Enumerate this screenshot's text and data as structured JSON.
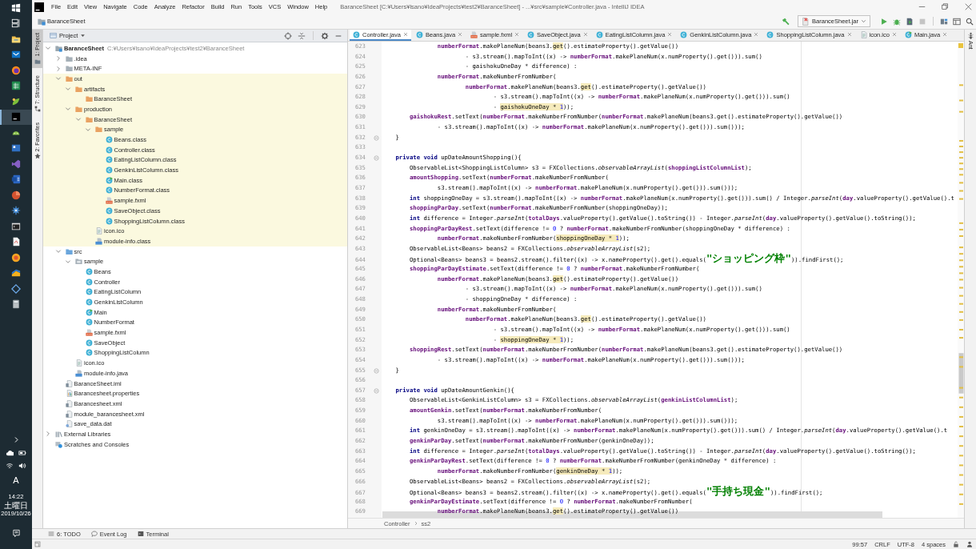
{
  "taskbar": {
    "apps": [
      {
        "selected": false
      },
      {
        "selected": false
      },
      {
        "selected": false
      },
      {
        "selected": false
      },
      {
        "selected": false
      },
      {
        "selected": true
      },
      {
        "selected": false
      },
      {
        "selected": false
      },
      {
        "selected": false
      },
      {
        "selected": false
      },
      {
        "selected": false
      },
      {
        "selected": false
      },
      {
        "selected": false
      },
      {
        "selected": false
      },
      {
        "selected": false
      },
      {
        "selected": false
      },
      {
        "selected": false
      },
      {
        "selected": false
      }
    ],
    "ime": "A",
    "clock": {
      "time": "14:22",
      "weekday": "土曜日",
      "date": "2019/10/26"
    }
  },
  "window": {
    "menus": [
      "File",
      "Edit",
      "View",
      "Navigate",
      "Code",
      "Analyze",
      "Refactor",
      "Build",
      "Run",
      "Tools",
      "VCS",
      "Window",
      "Help"
    ],
    "title": "BaranceSheet [C:¥Users¥lsano¥IdeaProjects¥test2¥BaranceSheet] - ...¥src¥sample¥Controller.java - IntelliJ IDEA"
  },
  "navigation_bar": {
    "breadcrumb": "BaranceSheet",
    "run_configuration": "BaranceSheet.jar",
    "stop_button": {
      "disabled": true
    }
  },
  "left_tool_stripe": [
    {
      "label": "1: Project",
      "selected": true
    },
    {
      "label": "7: Structure",
      "selected": false
    },
    {
      "label": "2: Favorites",
      "selected": false
    }
  ],
  "project_panel": {
    "title": "Project",
    "tree": [
      {
        "label": "BaranceSheet",
        "kind": "module",
        "hint": "C:¥Users¥lsano¥IdeaProjects¥test2¥BaranceSheet",
        "expanded": true,
        "excluded": false,
        "children": [
          {
            "label": ".idea",
            "kind": "folder",
            "expanded": false,
            "excluded": false
          },
          {
            "label": "META-INF",
            "kind": "folder",
            "expanded": false,
            "excluded": false
          },
          {
            "label": "out",
            "kind": "folder",
            "expanded": true,
            "excluded": true,
            "children": [
              {
                "label": "artifacts",
                "kind": "folder",
                "expanded": true,
                "excluded": true,
                "children": [
                  {
                    "label": "BaranceSheet",
                    "kind": "folder",
                    "excluded": true
                  }
                ]
              },
              {
                "label": "production",
                "kind": "folder",
                "expanded": true,
                "excluded": true,
                "children": [
                  {
                    "label": "BaranceSheet",
                    "kind": "folder",
                    "expanded": true,
                    "excluded": true,
                    "children": [
                      {
                        "label": "sample",
                        "kind": "folder",
                        "expanded": true,
                        "excluded": true,
                        "children": [
                          {
                            "label": "Beans.class",
                            "kind": "class",
                            "excluded": true
                          },
                          {
                            "label": "Controller.class",
                            "kind": "class",
                            "excluded": true
                          },
                          {
                            "label": "EatingListColumn.class",
                            "kind": "class",
                            "excluded": true
                          },
                          {
                            "label": "GenkinListColumn.class",
                            "kind": "class",
                            "excluded": true
                          },
                          {
                            "label": "Main.class",
                            "kind": "main-class",
                            "excluded": true
                          },
                          {
                            "label": "NumberFormat.class",
                            "kind": "class",
                            "excluded": true
                          },
                          {
                            "label": "sample.fxml",
                            "kind": "fxml",
                            "excluded": true
                          },
                          {
                            "label": "SaveObject.class",
                            "kind": "class",
                            "excluded": true
                          },
                          {
                            "label": "ShoppingListColumn.class",
                            "kind": "class",
                            "excluded": true
                          }
                        ]
                      },
                      {
                        "label": "icon.ico",
                        "kind": "image",
                        "excluded": true
                      },
                      {
                        "label": "module-info.class",
                        "kind": "module-info",
                        "excluded": true
                      }
                    ]
                  }
                ]
              }
            ]
          },
          {
            "label": "src",
            "kind": "source-folder",
            "expanded": true,
            "excluded": false,
            "children": [
              {
                "label": "sample",
                "kind": "package",
                "expanded": true,
                "excluded": false,
                "children": [
                  {
                    "label": "Beans",
                    "kind": "class",
                    "excluded": false
                  },
                  {
                    "label": "Controller",
                    "kind": "class",
                    "excluded": false
                  },
                  {
                    "label": "EatingListColumn",
                    "kind": "class",
                    "excluded": false
                  },
                  {
                    "label": "GenkinListColumn",
                    "kind": "class",
                    "excluded": false
                  },
                  {
                    "label": "Main",
                    "kind": "main-class",
                    "excluded": false
                  },
                  {
                    "label": "NumberFormat",
                    "kind": "class",
                    "excluded": false
                  },
                  {
                    "label": "sample.fxml",
                    "kind": "fxml",
                    "excluded": false
                  },
                  {
                    "label": "SaveObject",
                    "kind": "class",
                    "excluded": false
                  },
                  {
                    "label": "ShoppingListColumn",
                    "kind": "class",
                    "excluded": false
                  }
                ]
              },
              {
                "label": "icon.ico",
                "kind": "image",
                "excluded": false
              },
              {
                "label": "module-info.java",
                "kind": "module-info",
                "excluded": false
              }
            ]
          },
          {
            "label": "BaranceSheet.iml",
            "kind": "iml",
            "excluded": false
          },
          {
            "label": "Barancesheet.properties",
            "kind": "properties",
            "excluded": false
          },
          {
            "label": "Barancesheet.xml",
            "kind": "xml",
            "excluded": false
          },
          {
            "label": "module_barancesheet.xml",
            "kind": "xml",
            "excluded": false
          },
          {
            "label": "save_data.dat",
            "kind": "data",
            "excluded": false
          }
        ]
      },
      {
        "label": "External Libraries",
        "kind": "libraries",
        "expanded": false,
        "excluded": false
      },
      {
        "label": "Scratches and Consoles",
        "kind": "scratches",
        "excluded": false
      }
    ]
  },
  "editor": {
    "tabs": [
      {
        "label": "Controller.java",
        "kind": "class",
        "selected": true
      },
      {
        "label": "Beans.java",
        "kind": "class",
        "selected": false
      },
      {
        "label": "sample.fxml",
        "kind": "fxml",
        "selected": false
      },
      {
        "label": "SaveObject.java",
        "kind": "class",
        "selected": false
      },
      {
        "label": "EatingListColumn.java",
        "kind": "class",
        "selected": false
      },
      {
        "label": "GenkinListColumn.java",
        "kind": "class",
        "selected": false
      },
      {
        "label": "ShoppingListColumn.java",
        "kind": "class",
        "selected": false
      },
      {
        "label": "icon.ico",
        "kind": "image",
        "selected": false
      },
      {
        "label": "Main.java",
        "kind": "main-class",
        "selected": false
      }
    ],
    "lines": [
      {
        "number": "623",
        "fold": false,
        "code": [
          {
            "text": "                numberFormat",
            "kind": "field"
          },
          {
            "text": ".makePlaneNum(beans3.",
            "kind": "plain"
          },
          {
            "text": "get",
            "kind": "warning"
          },
          {
            "text": "().estimateProperty().getValue())",
            "kind": "plain"
          }
        ]
      },
      {
        "number": "624",
        "fold": false,
        "code": [
          {
            "text": "                        - s3.stream().mapToInt((x) -> ",
            "kind": "plain"
          },
          {
            "text": "numberFormat",
            "kind": "field"
          },
          {
            "text": ".makePlaneNum(x.numProperty().get())).sum()",
            "kind": "plain"
          }
        ]
      },
      {
        "number": "625",
        "fold": false,
        "code": [
          {
            "text": "                        - gaishokuOneDay * difference) :",
            "kind": "plain"
          }
        ]
      },
      {
        "number": "626",
        "fold": false,
        "code": [
          {
            "text": "                numberFormat",
            "kind": "field"
          },
          {
            "text": ".makeNumberFromNumber(",
            "kind": "plain"
          }
        ]
      },
      {
        "number": "627",
        "fold": false,
        "code": [
          {
            "text": "                        numberFormat",
            "kind": "field"
          },
          {
            "text": ".makePlaneNum(beans3.",
            "kind": "plain"
          },
          {
            "text": "get",
            "kind": "warning"
          },
          {
            "text": "().estimateProperty().getValue())",
            "kind": "plain"
          }
        ]
      },
      {
        "number": "628",
        "fold": false,
        "code": [
          {
            "text": "                                - s3.stream().mapToInt((x) -> ",
            "kind": "plain"
          },
          {
            "text": "numberFormat",
            "kind": "field"
          },
          {
            "text": ".makePlaneNum(x.numProperty().get())).sum()",
            "kind": "plain"
          }
        ]
      },
      {
        "number": "629",
        "fold": false,
        "code": [
          {
            "text": "                                - ",
            "kind": "plain"
          },
          {
            "text": "gaishokuOneDay * ",
            "kind": "warning"
          },
          {
            "text": "1",
            "kind": "warningnumber"
          },
          {
            "text": "));",
            "kind": "plain"
          }
        ]
      },
      {
        "number": "630",
        "fold": false,
        "code": [
          {
            "text": "        gaishokuRest",
            "kind": "field"
          },
          {
            "text": ".setText(",
            "kind": "plain"
          },
          {
            "text": "numberFormat",
            "kind": "field"
          },
          {
            "text": ".makeNumberFromNumber(",
            "kind": "plain"
          },
          {
            "text": "numberFormat",
            "kind": "field"
          },
          {
            "text": ".makePlaneNum(beans3.get().estimateProperty().getValue())",
            "kind": "plain"
          }
        ]
      },
      {
        "number": "631",
        "fold": false,
        "code": [
          {
            "text": "                - s3.stream().mapToInt((x) -> ",
            "kind": "plain"
          },
          {
            "text": "numberFormat",
            "kind": "field"
          },
          {
            "text": ".makePlaneNum(x.numProperty().get())).sum()));",
            "kind": "plain"
          }
        ]
      },
      {
        "number": "632",
        "fold": true,
        "code": [
          {
            "text": "    }",
            "kind": "plain"
          }
        ]
      },
      {
        "number": "633",
        "fold": false
      },
      {
        "number": "634",
        "fold": true,
        "code": [
          {
            "text": "    private void",
            "kind": "keyword"
          },
          {
            "text": " upDateAmountShopping(){",
            "kind": "plain"
          }
        ]
      },
      {
        "number": "635",
        "fold": false,
        "code": [
          {
            "text": "        ObservableList<ShoppingListColumn> s3 = FXCollections.",
            "kind": "plain"
          },
          {
            "text": "observableArrayList",
            "kind": "static"
          },
          {
            "text": "(",
            "kind": "plain"
          },
          {
            "text": "shoppingListColumnList",
            "kind": "field"
          },
          {
            "text": ");",
            "kind": "plain"
          }
        ]
      },
      {
        "number": "636",
        "fold": false,
        "code": [
          {
            "text": "        amountShopping",
            "kind": "field"
          },
          {
            "text": ".setText(",
            "kind": "plain"
          },
          {
            "text": "numberFormat",
            "kind": "field"
          },
          {
            "text": ".makeNumberFromNumber(",
            "kind": "plain"
          }
        ]
      },
      {
        "number": "637",
        "fold": false,
        "code": [
          {
            "text": "                s3.stream().mapToInt((x) -> ",
            "kind": "plain"
          },
          {
            "text": "numberFormat",
            "kind": "field"
          },
          {
            "text": ".makePlaneNum(x.numProperty().get())).sum()));",
            "kind": "plain"
          }
        ]
      },
      {
        "number": "638",
        "fold": false,
        "code": [
          {
            "text": "        int",
            "kind": "keyword"
          },
          {
            "text": " shoppingOneDay = s3.stream().mapToInt((x) -> ",
            "kind": "plain"
          },
          {
            "text": "numberFormat",
            "kind": "field"
          },
          {
            "text": ".makePlaneNum(x.numProperty().get())).sum() / Integer.",
            "kind": "plain"
          },
          {
            "text": "parseInt",
            "kind": "static"
          },
          {
            "text": "(",
            "kind": "plain"
          },
          {
            "text": "day",
            "kind": "field"
          },
          {
            "text": ".valueProperty().getValue().t",
            "kind": "plain"
          }
        ]
      },
      {
        "number": "639",
        "fold": false,
        "code": [
          {
            "text": "        shoppingParDay",
            "kind": "field"
          },
          {
            "text": ".setText(",
            "kind": "plain"
          },
          {
            "text": "numberFormat",
            "kind": "field"
          },
          {
            "text": ".makeNumberFromNumber(shoppingOneDay));",
            "kind": "plain"
          }
        ]
      },
      {
        "number": "640",
        "fold": false,
        "code": [
          {
            "text": "        int",
            "kind": "keyword"
          },
          {
            "text": " difference = Integer.",
            "kind": "plain"
          },
          {
            "text": "parseInt",
            "kind": "static"
          },
          {
            "text": "(",
            "kind": "plain"
          },
          {
            "text": "totalDays",
            "kind": "field"
          },
          {
            "text": ".valueProperty().getValue().toString()) - Integer.",
            "kind": "plain"
          },
          {
            "text": "parseInt",
            "kind": "static"
          },
          {
            "text": "(",
            "kind": "plain"
          },
          {
            "text": "day",
            "kind": "field"
          },
          {
            "text": ".valueProperty().getValue().toString());",
            "kind": "plain"
          }
        ]
      },
      {
        "number": "641",
        "fold": false,
        "code": [
          {
            "text": "        shoppingParDayRest",
            "kind": "field"
          },
          {
            "text": ".setText(difference != ",
            "kind": "plain"
          },
          {
            "text": "0",
            "kind": "number"
          },
          {
            "text": " ? ",
            "kind": "plain"
          },
          {
            "text": "numberFormat",
            "kind": "field"
          },
          {
            "text": ".makeNumberFromNumber(shoppingOneDay * difference) :",
            "kind": "plain"
          }
        ]
      },
      {
        "number": "642",
        "fold": false,
        "code": [
          {
            "text": "                numberFormat",
            "kind": "field"
          },
          {
            "text": ".makeNumberFromNumber(",
            "kind": "plain"
          },
          {
            "text": "shoppingOneDay * ",
            "kind": "warning"
          },
          {
            "text": "1",
            "kind": "warningnumber"
          },
          {
            "text": "));",
            "kind": "plain"
          }
        ]
      },
      {
        "number": "643",
        "fold": false,
        "code": [
          {
            "text": "        ObservableList<Beans> beans2 = FXCollections.",
            "kind": "plain"
          },
          {
            "text": "observableArrayList",
            "kind": "static"
          },
          {
            "text": "(s2);",
            "kind": "plain"
          }
        ]
      },
      {
        "number": "644",
        "fold": false,
        "code": [
          {
            "text": "        Optional<Beans> beans3 = beans2.stream().filter((x) -> x.nameProperty().get().equals(",
            "kind": "plain"
          },
          {
            "text": "\"ショッピング枠\"",
            "kind": "string"
          },
          {
            "text": ")).findFirst();",
            "kind": "plain"
          }
        ]
      },
      {
        "number": "645",
        "fold": false,
        "code": [
          {
            "text": "        shoppingParDayEstimate",
            "kind": "field"
          },
          {
            "text": ".setText(difference != ",
            "kind": "plain"
          },
          {
            "text": "0",
            "kind": "number"
          },
          {
            "text": " ? ",
            "kind": "plain"
          },
          {
            "text": "numberFormat",
            "kind": "field"
          },
          {
            "text": ".makeNumberFromNumber(",
            "kind": "plain"
          }
        ]
      },
      {
        "number": "646",
        "fold": false,
        "code": [
          {
            "text": "                numberFormat",
            "kind": "field"
          },
          {
            "text": ".makePlaneNum(beans3.",
            "kind": "plain"
          },
          {
            "text": "get",
            "kind": "warning"
          },
          {
            "text": "().estimateProperty().getValue())",
            "kind": "plain"
          }
        ]
      },
      {
        "number": "647",
        "fold": false,
        "code": [
          {
            "text": "                        - s3.stream().mapToInt((x) -> ",
            "kind": "plain"
          },
          {
            "text": "numberFormat",
            "kind": "field"
          },
          {
            "text": ".makePlaneNum(x.numProperty().get())).sum()",
            "kind": "plain"
          }
        ]
      },
      {
        "number": "648",
        "fold": false,
        "code": [
          {
            "text": "                        - shoppingOneDay * difference) :",
            "kind": "plain"
          }
        ]
      },
      {
        "number": "649",
        "fold": false,
        "code": [
          {
            "text": "                numberFormat",
            "kind": "field"
          },
          {
            "text": ".makeNumberFromNumber(",
            "kind": "plain"
          }
        ]
      },
      {
        "number": "650",
        "fold": false,
        "code": [
          {
            "text": "                        numberFormat",
            "kind": "field"
          },
          {
            "text": ".makePlaneNum(beans3.",
            "kind": "plain"
          },
          {
            "text": "get",
            "kind": "warning"
          },
          {
            "text": "().estimateProperty().getValue())",
            "kind": "plain"
          }
        ]
      },
      {
        "number": "651",
        "fold": false,
        "code": [
          {
            "text": "                                - s3.stream().mapToInt((x) -> ",
            "kind": "plain"
          },
          {
            "text": "numberFormat",
            "kind": "field"
          },
          {
            "text": ".makePlaneNum(x.numProperty().get())).sum()",
            "kind": "plain"
          }
        ]
      },
      {
        "number": "652",
        "fold": false,
        "code": [
          {
            "text": "                                - ",
            "kind": "plain"
          },
          {
            "text": "shoppingOneDay * ",
            "kind": "warning"
          },
          {
            "text": "1",
            "kind": "warningnumber"
          },
          {
            "text": "));",
            "kind": "plain"
          }
        ]
      },
      {
        "number": "653",
        "fold": false,
        "code": [
          {
            "text": "        shoppingRest",
            "kind": "field"
          },
          {
            "text": ".setText(",
            "kind": "plain"
          },
          {
            "text": "numberFormat",
            "kind": "field"
          },
          {
            "text": ".makeNumberFromNumber(",
            "kind": "plain"
          },
          {
            "text": "numberFormat",
            "kind": "field"
          },
          {
            "text": ".makePlaneNum(beans3.get().estimateProperty().getValue())",
            "kind": "plain"
          }
        ]
      },
      {
        "number": "654",
        "fold": false,
        "code": [
          {
            "text": "                - s3.stream().mapToInt((x) -> ",
            "kind": "plain"
          },
          {
            "text": "numberFormat",
            "kind": "field"
          },
          {
            "text": ".makePlaneNum(x.numProperty().get())).sum()));",
            "kind": "plain"
          }
        ]
      },
      {
        "number": "655",
        "fold": true,
        "code": [
          {
            "text": "    }",
            "kind": "plain"
          }
        ]
      },
      {
        "number": "656",
        "fold": false
      },
      {
        "number": "657",
        "fold": true,
        "code": [
          {
            "text": "    private void",
            "kind": "keyword"
          },
          {
            "text": " upDateAmountGenkin(){",
            "kind": "plain"
          }
        ]
      },
      {
        "number": "658",
        "fold": false,
        "code": [
          {
            "text": "        ObservableList<GenkinListColumn> s3 = FXCollections.",
            "kind": "plain"
          },
          {
            "text": "observableArrayList",
            "kind": "static"
          },
          {
            "text": "(",
            "kind": "plain"
          },
          {
            "text": "genkinListColumnList",
            "kind": "field"
          },
          {
            "text": ");",
            "kind": "plain"
          }
        ]
      },
      {
        "number": "659",
        "fold": false,
        "code": [
          {
            "text": "        amountGenkin",
            "kind": "field"
          },
          {
            "text": ".setText(",
            "kind": "plain"
          },
          {
            "text": "numberFormat",
            "kind": "field"
          },
          {
            "text": ".makeNumberFromNumber(",
            "kind": "plain"
          }
        ]
      },
      {
        "number": "660",
        "fold": false,
        "code": [
          {
            "text": "                s3.stream().mapToInt((x) -> ",
            "kind": "plain"
          },
          {
            "text": "numberFormat",
            "kind": "field"
          },
          {
            "text": ".makePlaneNum(x.numProperty().get())).sum()));",
            "kind": "plain"
          }
        ]
      },
      {
        "number": "661",
        "fold": false,
        "code": [
          {
            "text": "        int",
            "kind": "keyword"
          },
          {
            "text": " genkinOneDay = s3.stream().mapToInt((x) -> ",
            "kind": "plain"
          },
          {
            "text": "numberFormat",
            "kind": "field"
          },
          {
            "text": ".makePlaneNum(x.numProperty().get())).sum() / Integer.",
            "kind": "plain"
          },
          {
            "text": "parseInt",
            "kind": "static"
          },
          {
            "text": "(",
            "kind": "plain"
          },
          {
            "text": "day",
            "kind": "field"
          },
          {
            "text": ".valueProperty().getValue().t",
            "kind": "plain"
          }
        ]
      },
      {
        "number": "662",
        "fold": false,
        "code": [
          {
            "text": "        genkinParDay",
            "kind": "field"
          },
          {
            "text": ".setText(",
            "kind": "plain"
          },
          {
            "text": "numberFormat",
            "kind": "field"
          },
          {
            "text": ".makeNumberFromNumber(genkinOneDay));",
            "kind": "plain"
          }
        ]
      },
      {
        "number": "663",
        "fold": false,
        "code": [
          {
            "text": "        int",
            "kind": "keyword"
          },
          {
            "text": " difference = Integer.",
            "kind": "plain"
          },
          {
            "text": "parseInt",
            "kind": "static"
          },
          {
            "text": "(",
            "kind": "plain"
          },
          {
            "text": "totalDays",
            "kind": "field"
          },
          {
            "text": ".valueProperty().getValue().toString()) - Integer.",
            "kind": "plain"
          },
          {
            "text": "parseInt",
            "kind": "static"
          },
          {
            "text": "(",
            "kind": "plain"
          },
          {
            "text": "day",
            "kind": "field"
          },
          {
            "text": ".valueProperty().getValue().toString());",
            "kind": "plain"
          }
        ]
      },
      {
        "number": "664",
        "fold": false,
        "code": [
          {
            "text": "        genkinParDayRest",
            "kind": "field"
          },
          {
            "text": ".setText(difference != ",
            "kind": "plain"
          },
          {
            "text": "0",
            "kind": "number"
          },
          {
            "text": " ? ",
            "kind": "plain"
          },
          {
            "text": "numberFormat",
            "kind": "field"
          },
          {
            "text": ".makeNumberFromNumber(genkinOneDay * difference) :",
            "kind": "plain"
          }
        ]
      },
      {
        "number": "665",
        "fold": false,
        "code": [
          {
            "text": "                numberFormat",
            "kind": "field"
          },
          {
            "text": ".makeNumberFromNumber(",
            "kind": "plain"
          },
          {
            "text": "genkinOneDay * ",
            "kind": "warning"
          },
          {
            "text": "1",
            "kind": "warningnumber"
          },
          {
            "text": "));",
            "kind": "plain"
          }
        ]
      },
      {
        "number": "666",
        "fold": false,
        "code": [
          {
            "text": "        ObservableList<Beans> beans2 = FXCollections.",
            "kind": "plain"
          },
          {
            "text": "observableArrayList",
            "kind": "static"
          },
          {
            "text": "(s2);",
            "kind": "plain"
          }
        ]
      },
      {
        "number": "667",
        "fold": false,
        "code": [
          {
            "text": "        Optional<Beans> beans3 = beans2.stream().filter((x) -> x.nameProperty().get().equals(",
            "kind": "plain"
          },
          {
            "text": "\"手持ち現金\"",
            "kind": "string"
          },
          {
            "text": ")).findFirst();",
            "kind": "plain"
          }
        ]
      },
      {
        "number": "668",
        "fold": false,
        "code": [
          {
            "text": "        genkinParDayEstimate",
            "kind": "field"
          },
          {
            "text": ".setText(difference != ",
            "kind": "plain"
          },
          {
            "text": "0",
            "kind": "number"
          },
          {
            "text": " ? ",
            "kind": "plain"
          },
          {
            "text": "numberFormat",
            "kind": "field"
          },
          {
            "text": ".makeNumberFromNumber(",
            "kind": "plain"
          }
        ]
      },
      {
        "number": "669",
        "fold": false,
        "code": [
          {
            "text": "                numberFormat",
            "kind": "field"
          },
          {
            "text": ".makePlaneNum(beans3.",
            "kind": "plain"
          },
          {
            "text": "get",
            "kind": "warning"
          },
          {
            "text": "().estimateProperty().getValue())",
            "kind": "plain"
          }
        ]
      }
    ],
    "breadcrumbs": [
      "Controller",
      "ss2"
    ]
  },
  "right_tool_stripe": [
    {
      "label": "Ant"
    }
  ],
  "bottom_tool_buttons": [
    "6: TODO",
    "Event Log",
    "Terminal"
  ],
  "status_bar": {
    "caret": "99:57",
    "line_separator": "CRLF",
    "encoding": "UTF-8",
    "indent": "4 spaces"
  }
}
